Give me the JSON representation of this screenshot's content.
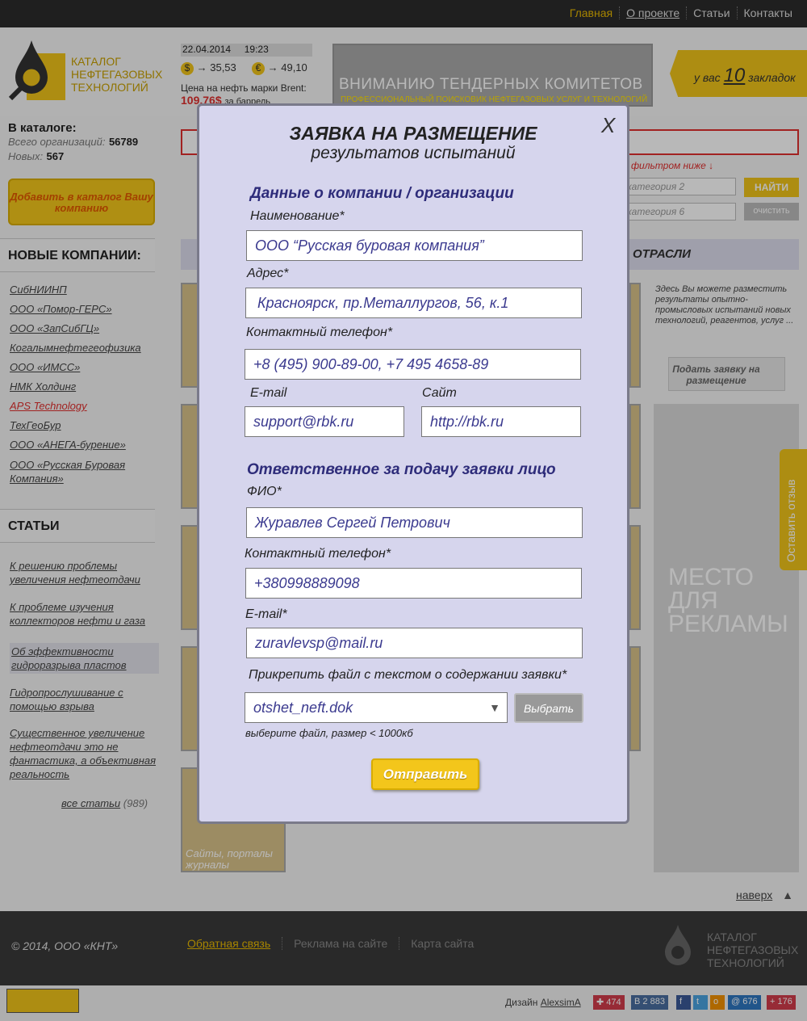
{
  "top_nav": [
    "Главная",
    "О проекте",
    "Статьи",
    "Контакты"
  ],
  "logo_text": [
    "КАТАЛОГ",
    "НЕФТЕГАЗОВЫХ",
    "ТЕХНОЛОГИЙ"
  ],
  "ticker": {
    "date": "22.04.2014",
    "time": "19:23",
    "usd": "35,53",
    "eur": "49,10",
    "oil_label": "Цена на нефть марки Brent:",
    "oil_value": "109,76$",
    "oil_unit": "за баррель"
  },
  "banner": {
    "title": "ВНИМАНИЮ ТЕНДЕРНЫХ КОМИТЕТОВ",
    "subtitle": "профессиональный поисковик нефтегазовых услуг и технологий"
  },
  "bookmarks": {
    "prefix": "у вас",
    "count": "10",
    "suffix": "закладок"
  },
  "catalog": {
    "title": "В каталоге:",
    "total_label": "Всего организаций:",
    "total": "56789",
    "new_label": "Новых:",
    "new": "567",
    "add_button": "Добавить в каталог Вашу компанию"
  },
  "new_companies": {
    "title": "НОВЫЕ КОМПАНИИ:",
    "items": [
      "СибНИИНП",
      "ООО «Помор-ГЕРС»",
      "ООО «ЗапСибГЦ»",
      "Когалымнефтегеофизика",
      "ООО «ИМСС»",
      "НМК Холдинг",
      "APS Technology",
      "ТехГеоБур",
      "ООО «АНЕГА-бурение»",
      "ООО «Русская Буровая Компания»"
    ]
  },
  "articles": {
    "title": "СТАТЬИ",
    "items": [
      "К решению проблемы увеличения нефтеотдачи",
      "К проблеме изучения коллекторов нефти и газа",
      "Об эффективности гидроразрыва пластов",
      "Гидропрослушивание с помощью взрыва",
      "Существенное увеличение нефтеотдачи это не фантастика, а объективная реальность"
    ],
    "all_label": "все статьи",
    "all_count": "(989)"
  },
  "search": {
    "filter_note": "фильтром ниже ↓",
    "category2": "категория 2",
    "category6": "категория 6",
    "find_button": "НАЙТИ",
    "clear_button": "очистить"
  },
  "industry_title": "ОТРАСЛИ",
  "side_promo": {
    "text": "Здесь Вы можете разместить результаты опытно-промысловых испытаний новых технологий, реагентов, услуг ...",
    "button": "Подать заявку на размещение"
  },
  "ad_placeholder": "МЕСТО ДЛЯ РЕКЛАМЫ",
  "feedback_tab": "Оставить отзыв",
  "card_caption": "Сайты, порталы журналы",
  "to_top": "наверх",
  "footer": {
    "copyright": "© 2014, ООО «КНТ»",
    "links": [
      "Обратная связь",
      "Реклама на сайте",
      "Карта сайта"
    ],
    "logo_text": [
      "КАТАЛОГ",
      "НЕФТЕГАЗОВЫХ",
      "ТЕХНОЛОГИЙ"
    ],
    "design_label": "Дизайн",
    "designer": "AlexsimA",
    "social_counts": [
      "474",
      "2 883",
      "676",
      "176"
    ]
  },
  "modal": {
    "close": "X",
    "title": "ЗАЯВКА НА РАЗМЕЩЕНИЕ",
    "subtitle": "результатов испытаний",
    "company_section": "Данные о компании / организации",
    "name_label": "Наименование*",
    "name_value": "ООО “Русская буровая компания”",
    "address_label": "Адрес*",
    "address_value": "Красноярск, пр.Металлургов, 56, к.1",
    "phone_label": "Контактный телефон*",
    "phone_value": "+8 (495) 900-89-00, +7 495 4658-89",
    "email_label": "E-mail",
    "email_value": "support@rbk.ru",
    "site_label": "Сайт",
    "site_value": "http://rbk.ru",
    "person_section": "Ответственное за подачу заявки лицо",
    "fio_label": "ФИО*",
    "fio_value": "Журавлев Сергей Петрович",
    "person_phone_label": "Контактный телефон*",
    "person_phone_value": "+380998889098",
    "person_email_label": "E-mail*",
    "person_email_value": "zuravlevsp@mail.ru",
    "file_label": "Прикрепить файл с текстом о содержании заявки*",
    "file_value": "otshet_neft.dok",
    "choose_button": "Выбрать",
    "file_hint": "выберите файл, размер < 1000кб",
    "submit_button": "Отправить"
  }
}
